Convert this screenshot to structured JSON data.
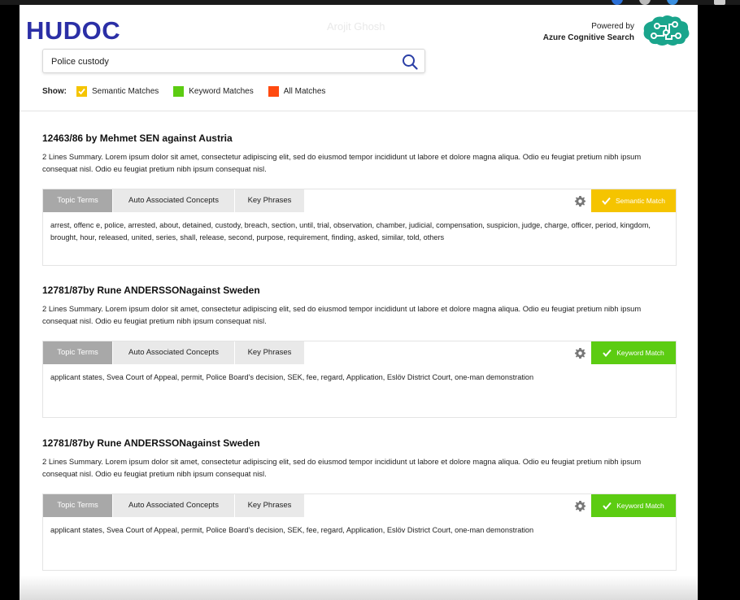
{
  "header": {
    "logo": "HUDOC",
    "user_name": "Arojit Ghosh",
    "powered_by_line1": "Powered by",
    "powered_by_line2": "Azure Cognitive Search"
  },
  "search": {
    "value": "Police custody",
    "placeholder": ""
  },
  "filters": {
    "show_label": "Show:",
    "items": [
      {
        "label": "Semantic Matches",
        "color": "#f5c400",
        "checked": true
      },
      {
        "label": "Keyword Matches",
        "color": "#5ccc12",
        "checked": false
      },
      {
        "label": "All Matches",
        "color": "#ff4a10",
        "checked": false
      }
    ]
  },
  "tabs": {
    "topic_terms": "Topic Terms",
    "auto_concepts": "Auto Associated Concepts",
    "key_phrases": "Key Phrases"
  },
  "results": [
    {
      "title": "12463/86 by Mehmet SEN against Austria",
      "summary": "2 Lines Summary. Lorem ipsum dolor sit amet, consectetur adipiscing elit, sed do eiusmod tempor incididunt ut labore et dolore magna aliqua. Odio eu feugiat pretium nibh ipsum consequat nisl. Odio eu feugiat pretium nibh ipsum consequat nisl.",
      "match_label": "Semantic Match",
      "match_color": "#f5c400",
      "terms": "arrest, offenc e, police, arrested, about, detained, custody, breach, section, until, trial, observation, chamber, judicial, compensation, suspicion, judge, charge, officer, period, kingdom, brought, hour, released, united, series, shall, release, second, purpose, requirement, finding, asked, similar, told, others"
    },
    {
      "title": "12781/87by Rune ANDERSSONagainst Sweden",
      "summary": "2 Lines Summary. Lorem ipsum dolor sit amet, consectetur adipiscing elit, sed do eiusmod tempor incididunt ut labore et dolore magna aliqua. Odio eu feugiat pretium nibh ipsum consequat nisl. Odio eu feugiat pretium nibh ipsum consequat nisl.",
      "match_label": "Keyword Match",
      "match_color": "#5ccc12",
      "terms": "applicant states, Svea Court of Appeal, permit, Police Board's decision, SEK, fee, regard, Application, Eslöv District Court, one-man demonstration"
    },
    {
      "title": "12781/87by Rune ANDERSSONagainst Sweden",
      "summary": "2 Lines Summary. Lorem ipsum dolor sit amet, consectetur adipiscing elit, sed do eiusmod tempor incididunt ut labore et dolore magna aliqua. Odio eu feugiat pretium nibh ipsum consequat nisl. Odio eu feugiat pretium nibh ipsum consequat nisl.",
      "match_label": "Keyword Match",
      "match_color": "#5ccc12",
      "terms": "applicant states, Svea Court of Appeal, permit, Police Board's decision, SEK, fee, regard, Application, Eslöv District Court, one-man demonstration"
    }
  ]
}
